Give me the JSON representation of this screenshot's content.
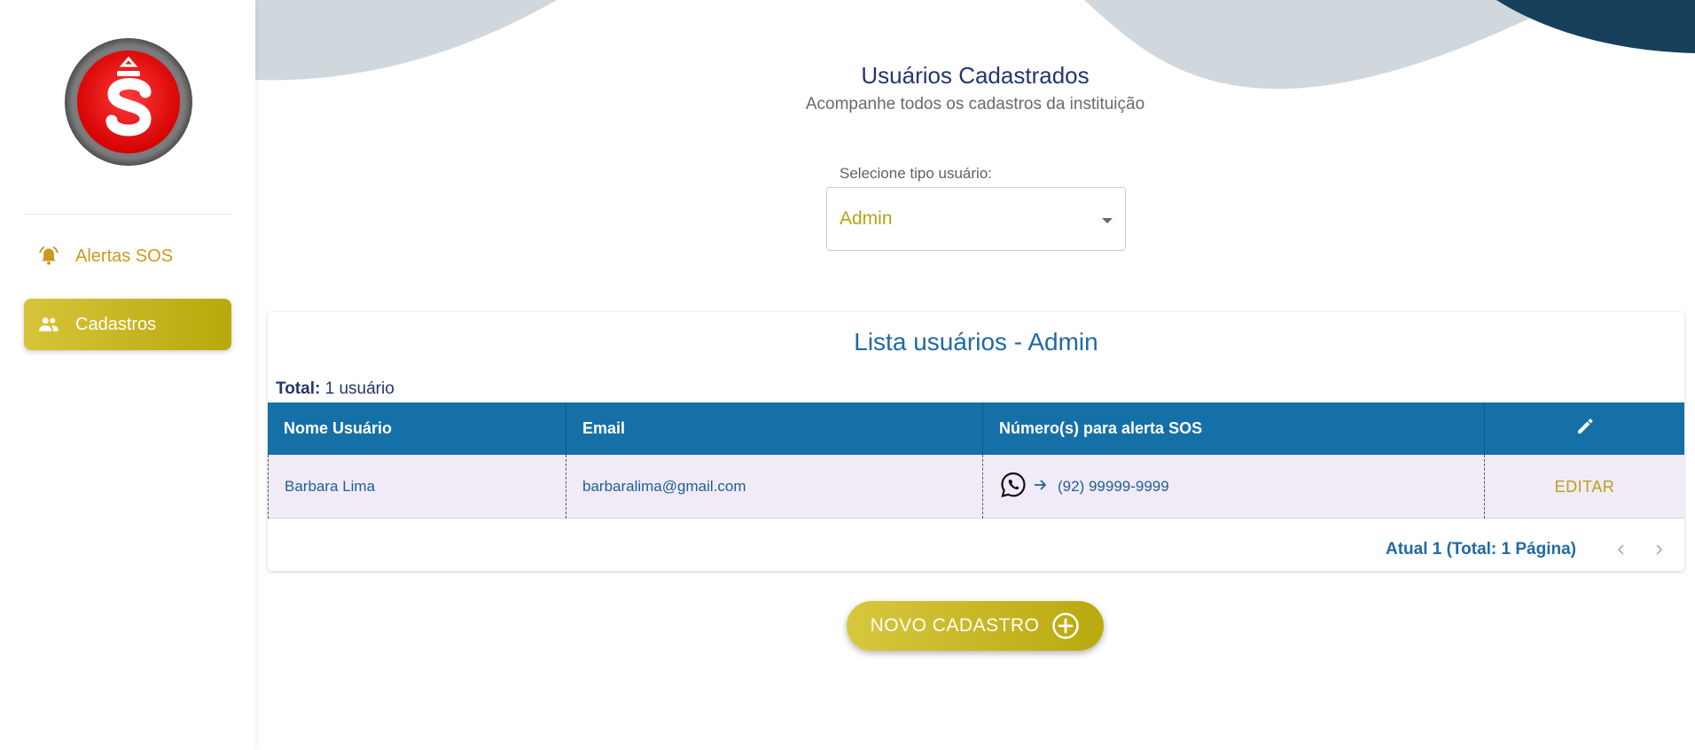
{
  "sidebar": {
    "logo_icon": "sos-siren-logo",
    "items": [
      {
        "label": "Alertas SOS",
        "icon": "alarm-bell-icon"
      },
      {
        "label": "Cadastros",
        "icon": "users-group-icon"
      }
    ]
  },
  "header": {
    "title": "Usuários Cadastrados",
    "subtitle": "Acompanhe todos os cadastros da instituição"
  },
  "filter": {
    "label": "Selecione tipo usuário:",
    "selected": "Admin"
  },
  "list": {
    "title": "Lista usuários - Admin",
    "total_label": "Total:",
    "total_value": "1 usuário",
    "columns": [
      "Nome Usuário",
      "Email",
      "Número(s) para alerta SOS"
    ],
    "edit_column_icon": "pencil-icon",
    "rows": [
      {
        "name": "Barbara Lima",
        "email": "barbaralima@gmail.com",
        "phone": "(92) 99999-9999",
        "action": "EDITAR"
      }
    ],
    "pagination": "Atual 1 (Total: 1 Página)"
  },
  "new_button": {
    "label": "NOVO CADASTRO",
    "icon": "plus-circle-icon"
  },
  "colors": {
    "primary_blue": "#1670a8",
    "gold": "#b5a219",
    "navy": "#24366f",
    "row_bg": "#f1ebf8"
  }
}
